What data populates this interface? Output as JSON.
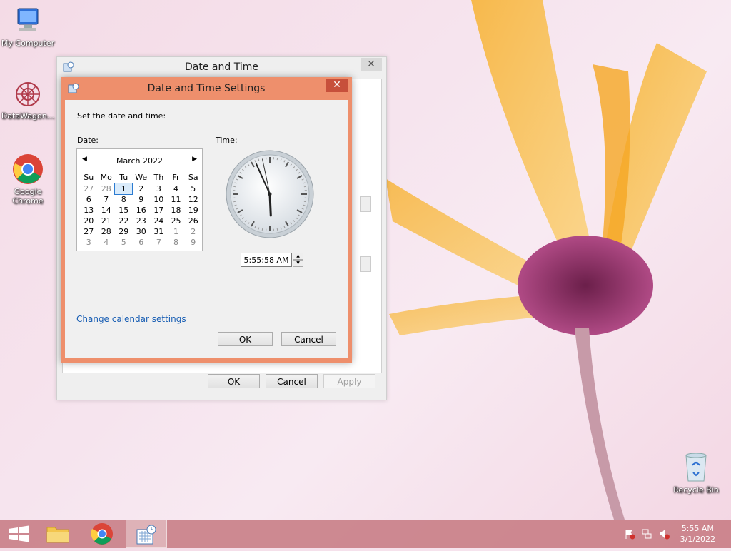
{
  "desktop": {
    "icons": [
      {
        "label": "My Computer"
      },
      {
        "label": "DataWagon..."
      },
      {
        "label": "Google Chrome"
      },
      {
        "label": "Recycle Bin"
      }
    ]
  },
  "outer_dialog": {
    "title": "Date and Time",
    "close_symbol": "✕",
    "buttons": {
      "ok": "OK",
      "cancel": "Cancel",
      "apply": "Apply"
    }
  },
  "inner_dialog": {
    "title": "Date and Time Settings",
    "close_symbol": "✕",
    "instruction": "Set the date and time:",
    "date_label": "Date:",
    "time_label": "Time:",
    "calendar": {
      "month": "March 2022",
      "weekdays": [
        "Su",
        "Mo",
        "Tu",
        "We",
        "Th",
        "Fr",
        "Sa"
      ],
      "weeks": [
        [
          "27",
          "28",
          "1",
          "2",
          "3",
          "4",
          "5"
        ],
        [
          "6",
          "7",
          "8",
          "9",
          "10",
          "11",
          "12"
        ],
        [
          "13",
          "14",
          "15",
          "16",
          "17",
          "18",
          "19"
        ],
        [
          "20",
          "21",
          "22",
          "23",
          "24",
          "25",
          "26"
        ],
        [
          "27",
          "28",
          "29",
          "30",
          "31",
          "1",
          "2"
        ],
        [
          "3",
          "4",
          "5",
          "6",
          "7",
          "8",
          "9"
        ]
      ],
      "selected": "1"
    },
    "time_value": "5:55:58 AM",
    "change_calendar_link": "Change calendar settings",
    "buttons": {
      "ok": "OK",
      "cancel": "Cancel"
    }
  },
  "clock_time": {
    "h": 5,
    "m": 55,
    "s": 58
  },
  "taskbar": {
    "time": "5:55 AM",
    "date": "3/1/2022"
  }
}
